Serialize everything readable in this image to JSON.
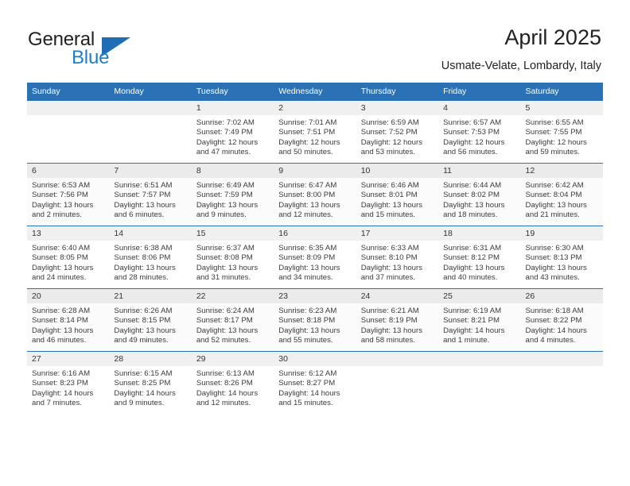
{
  "brand": {
    "name_top": "General",
    "name_bottom": "Blue",
    "triangle_color": "#1f6eb5",
    "blue_text_color": "#1f7fc4"
  },
  "header": {
    "title": "April 2025",
    "subtitle": "Usmate-Velate, Lombardy, Italy"
  },
  "theme": {
    "header_blue": "#2a72b5",
    "day_strip_gray": "#f0f0f0",
    "text_color": "#3b3b3b"
  },
  "weekdays": [
    "Sunday",
    "Monday",
    "Tuesday",
    "Wednesday",
    "Thursday",
    "Friday",
    "Saturday"
  ],
  "labels": {
    "sunrise_prefix": "Sunrise:",
    "sunset_prefix": "Sunset:",
    "daylight_prefix": "Daylight:"
  },
  "weeks": [
    [
      {
        "day": "",
        "sunrise": "",
        "sunset": "",
        "daylight_line1": "",
        "daylight_line2": ""
      },
      {
        "day": "",
        "sunrise": "",
        "sunset": "",
        "daylight_line1": "",
        "daylight_line2": ""
      },
      {
        "day": "1",
        "sunrise": "Sunrise: 7:02 AM",
        "sunset": "Sunset: 7:49 PM",
        "daylight_line1": "Daylight: 12 hours",
        "daylight_line2": "and 47 minutes."
      },
      {
        "day": "2",
        "sunrise": "Sunrise: 7:01 AM",
        "sunset": "Sunset: 7:51 PM",
        "daylight_line1": "Daylight: 12 hours",
        "daylight_line2": "and 50 minutes."
      },
      {
        "day": "3",
        "sunrise": "Sunrise: 6:59 AM",
        "sunset": "Sunset: 7:52 PM",
        "daylight_line1": "Daylight: 12 hours",
        "daylight_line2": "and 53 minutes."
      },
      {
        "day": "4",
        "sunrise": "Sunrise: 6:57 AM",
        "sunset": "Sunset: 7:53 PM",
        "daylight_line1": "Daylight: 12 hours",
        "daylight_line2": "and 56 minutes."
      },
      {
        "day": "5",
        "sunrise": "Sunrise: 6:55 AM",
        "sunset": "Sunset: 7:55 PM",
        "daylight_line1": "Daylight: 12 hours",
        "daylight_line2": "and 59 minutes."
      }
    ],
    [
      {
        "day": "6",
        "sunrise": "Sunrise: 6:53 AM",
        "sunset": "Sunset: 7:56 PM",
        "daylight_line1": "Daylight: 13 hours",
        "daylight_line2": "and 2 minutes."
      },
      {
        "day": "7",
        "sunrise": "Sunrise: 6:51 AM",
        "sunset": "Sunset: 7:57 PM",
        "daylight_line1": "Daylight: 13 hours",
        "daylight_line2": "and 6 minutes."
      },
      {
        "day": "8",
        "sunrise": "Sunrise: 6:49 AM",
        "sunset": "Sunset: 7:59 PM",
        "daylight_line1": "Daylight: 13 hours",
        "daylight_line2": "and 9 minutes."
      },
      {
        "day": "9",
        "sunrise": "Sunrise: 6:47 AM",
        "sunset": "Sunset: 8:00 PM",
        "daylight_line1": "Daylight: 13 hours",
        "daylight_line2": "and 12 minutes."
      },
      {
        "day": "10",
        "sunrise": "Sunrise: 6:46 AM",
        "sunset": "Sunset: 8:01 PM",
        "daylight_line1": "Daylight: 13 hours",
        "daylight_line2": "and 15 minutes."
      },
      {
        "day": "11",
        "sunrise": "Sunrise: 6:44 AM",
        "sunset": "Sunset: 8:02 PM",
        "daylight_line1": "Daylight: 13 hours",
        "daylight_line2": "and 18 minutes."
      },
      {
        "day": "12",
        "sunrise": "Sunrise: 6:42 AM",
        "sunset": "Sunset: 8:04 PM",
        "daylight_line1": "Daylight: 13 hours",
        "daylight_line2": "and 21 minutes."
      }
    ],
    [
      {
        "day": "13",
        "sunrise": "Sunrise: 6:40 AM",
        "sunset": "Sunset: 8:05 PM",
        "daylight_line1": "Daylight: 13 hours",
        "daylight_line2": "and 24 minutes."
      },
      {
        "day": "14",
        "sunrise": "Sunrise: 6:38 AM",
        "sunset": "Sunset: 8:06 PM",
        "daylight_line1": "Daylight: 13 hours",
        "daylight_line2": "and 28 minutes."
      },
      {
        "day": "15",
        "sunrise": "Sunrise: 6:37 AM",
        "sunset": "Sunset: 8:08 PM",
        "daylight_line1": "Daylight: 13 hours",
        "daylight_line2": "and 31 minutes."
      },
      {
        "day": "16",
        "sunrise": "Sunrise: 6:35 AM",
        "sunset": "Sunset: 8:09 PM",
        "daylight_line1": "Daylight: 13 hours",
        "daylight_line2": "and 34 minutes."
      },
      {
        "day": "17",
        "sunrise": "Sunrise: 6:33 AM",
        "sunset": "Sunset: 8:10 PM",
        "daylight_line1": "Daylight: 13 hours",
        "daylight_line2": "and 37 minutes."
      },
      {
        "day": "18",
        "sunrise": "Sunrise: 6:31 AM",
        "sunset": "Sunset: 8:12 PM",
        "daylight_line1": "Daylight: 13 hours",
        "daylight_line2": "and 40 minutes."
      },
      {
        "day": "19",
        "sunrise": "Sunrise: 6:30 AM",
        "sunset": "Sunset: 8:13 PM",
        "daylight_line1": "Daylight: 13 hours",
        "daylight_line2": "and 43 minutes."
      }
    ],
    [
      {
        "day": "20",
        "sunrise": "Sunrise: 6:28 AM",
        "sunset": "Sunset: 8:14 PM",
        "daylight_line1": "Daylight: 13 hours",
        "daylight_line2": "and 46 minutes."
      },
      {
        "day": "21",
        "sunrise": "Sunrise: 6:26 AM",
        "sunset": "Sunset: 8:15 PM",
        "daylight_line1": "Daylight: 13 hours",
        "daylight_line2": "and 49 minutes."
      },
      {
        "day": "22",
        "sunrise": "Sunrise: 6:24 AM",
        "sunset": "Sunset: 8:17 PM",
        "daylight_line1": "Daylight: 13 hours",
        "daylight_line2": "and 52 minutes."
      },
      {
        "day": "23",
        "sunrise": "Sunrise: 6:23 AM",
        "sunset": "Sunset: 8:18 PM",
        "daylight_line1": "Daylight: 13 hours",
        "daylight_line2": "and 55 minutes."
      },
      {
        "day": "24",
        "sunrise": "Sunrise: 6:21 AM",
        "sunset": "Sunset: 8:19 PM",
        "daylight_line1": "Daylight: 13 hours",
        "daylight_line2": "and 58 minutes."
      },
      {
        "day": "25",
        "sunrise": "Sunrise: 6:19 AM",
        "sunset": "Sunset: 8:21 PM",
        "daylight_line1": "Daylight: 14 hours",
        "daylight_line2": "and 1 minute."
      },
      {
        "day": "26",
        "sunrise": "Sunrise: 6:18 AM",
        "sunset": "Sunset: 8:22 PM",
        "daylight_line1": "Daylight: 14 hours",
        "daylight_line2": "and 4 minutes."
      }
    ],
    [
      {
        "day": "27",
        "sunrise": "Sunrise: 6:16 AM",
        "sunset": "Sunset: 8:23 PM",
        "daylight_line1": "Daylight: 14 hours",
        "daylight_line2": "and 7 minutes."
      },
      {
        "day": "28",
        "sunrise": "Sunrise: 6:15 AM",
        "sunset": "Sunset: 8:25 PM",
        "daylight_line1": "Daylight: 14 hours",
        "daylight_line2": "and 9 minutes."
      },
      {
        "day": "29",
        "sunrise": "Sunrise: 6:13 AM",
        "sunset": "Sunset: 8:26 PM",
        "daylight_line1": "Daylight: 14 hours",
        "daylight_line2": "and 12 minutes."
      },
      {
        "day": "30",
        "sunrise": "Sunrise: 6:12 AM",
        "sunset": "Sunset: 8:27 PM",
        "daylight_line1": "Daylight: 14 hours",
        "daylight_line2": "and 15 minutes."
      },
      {
        "day": "",
        "sunrise": "",
        "sunset": "",
        "daylight_line1": "",
        "daylight_line2": ""
      },
      {
        "day": "",
        "sunrise": "",
        "sunset": "",
        "daylight_line1": "",
        "daylight_line2": ""
      },
      {
        "day": "",
        "sunrise": "",
        "sunset": "",
        "daylight_line1": "",
        "daylight_line2": ""
      }
    ]
  ]
}
